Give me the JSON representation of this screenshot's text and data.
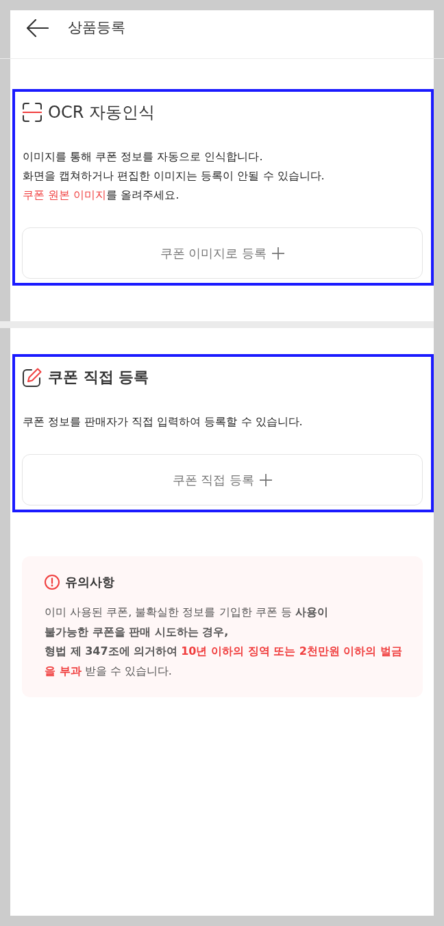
{
  "header": {
    "title": "상품등록"
  },
  "sections": [
    {
      "kind": "ocr",
      "highlighted": true,
      "title": "OCR 자동인식",
      "description": [
        [
          {
            "text": "이미지를 통해 쿠폰 정보를 자동으로 인식합니다.",
            "emphasized": false
          }
        ],
        [
          {
            "text": "화면을 캡쳐하거나 편집한 이미지는 등록이 안될 수 있습니다.",
            "emphasized": false
          }
        ],
        [
          {
            "text": "쿠폰 원본 이미지",
            "emphasized": true
          },
          {
            "text": "를 올려주세요.",
            "emphasized": false
          }
        ]
      ],
      "button": "쿠폰 이미지로 등록"
    },
    {
      "kind": "manual",
      "highlighted": true,
      "title": "쿠폰 직접 등록",
      "description": [
        [
          {
            "text": "쿠폰 정보를 판매자가 직접 입력하여 등록할 수 있습니다.",
            "emphasized": false
          }
        ]
      ],
      "button": "쿠폰 직접 등록"
    }
  ],
  "notice": {
    "title": "유의사항",
    "body": [
      [
        {
          "text": "이미 사용된 쿠폰, 불확실한 정보를 기입한 쿠폰 등 **사용이**",
          "emphasized": false
        }
      ],
      [
        {
          "text": "**불가능한 쿠폰을 판매 시도하는 경우,**",
          "emphasized": false
        }
      ],
      [
        {
          "text": "**형법 제 347조에 의거하여** ",
          "emphasized": false
        },
        {
          "text": "10년 이하의 징역 또는 2천만원 이하의 벌금을 부과",
          "emphasized": true
        },
        {
          "text": " 받을 수 있습니다.",
          "emphasized": false
        }
      ]
    ]
  }
}
